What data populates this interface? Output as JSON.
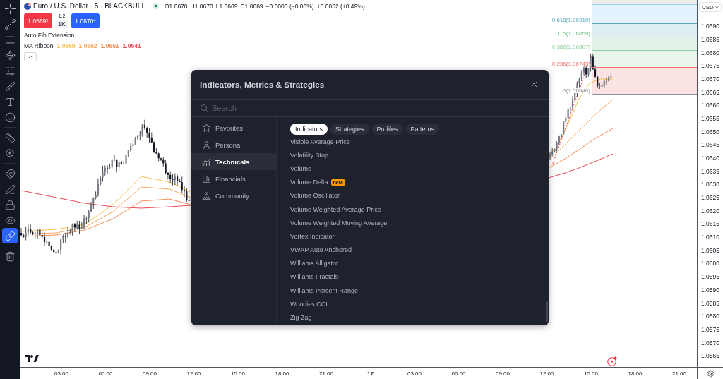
{
  "toolbar": {
    "groups": [
      {
        "tools": [
          {
            "selected": false
          },
          {
            "selected": false
          },
          {
            "selected": false
          },
          {
            "selected": false
          },
          {
            "selected": false
          },
          {
            "selected": false
          },
          {
            "selected": false
          },
          {
            "selected": false
          }
        ]
      },
      {
        "tools": [
          {
            "selected": false
          },
          {
            "selected": false
          }
        ]
      },
      {
        "tools": [
          {
            "selected": false
          },
          {
            "selected": false
          },
          {
            "selected": false
          },
          {
            "selected": false
          },
          {
            "selected": true
          }
        ]
      },
      {
        "tools": [
          {
            "selected": false
          }
        ]
      }
    ]
  },
  "legend": {
    "title": "Euro / U.S. Dollar · 5 · BLACKBULL",
    "quote": [
      "O1.0670",
      "H1.0670",
      "L1.0669",
      "C1.0669",
      "−0.0000 (−0.00%)",
      "+0.0052 (+0.49%)"
    ],
    "sell_price": "1.0669$^{2}$",
    "spread": "1.2",
    "quantity": "1K",
    "buy_price": "1.0670$^{4}$",
    "studies": [
      {
        "name": "Auto Fib Extension"
      },
      {
        "name": "MA Ribbon",
        "values": [
          {
            "text": "1.0669",
            "color": "#f5c14e"
          },
          {
            "text": "1.0662",
            "color": "#f9a85f"
          },
          {
            "text": "1.0651",
            "color": "#f28c55"
          },
          {
            "text": "1.0641",
            "color": "#e84c55"
          }
        ]
      }
    ]
  },
  "fib_levels": [
    {
      "label": "0.618(1.06910)",
      "color": "#5aa9bd"
    },
    {
      "label": "0.5(1.06859)",
      "color": "#72c08f"
    },
    {
      "label": "0.382(1.06807)",
      "color": "#8fcf9c"
    },
    {
      "label": "0.236(1.06743)",
      "color": "#f07373"
    },
    {
      "label": "0(1.06640)",
      "color": "#8e919a"
    }
  ],
  "price_axis": {
    "currency": "USD",
    "labels": [
      "1.0690",
      "1.0685",
      "1.0680",
      "1.0675",
      "1.0670",
      "1.0665",
      "1.0660",
      "1.0655",
      "1.0650",
      "1.0645",
      "1.0640",
      "1.0635",
      "1.0630",
      "1.0625",
      "1.0620",
      "1.0615",
      "1.0610",
      "1.0605",
      "1.0600",
      "1.0595",
      "1.0590",
      "1.0585",
      "1.0580",
      "1.0575",
      "1.0570",
      "1.0565"
    ]
  },
  "time_axis": {
    "labels": [
      {
        "text": "03:00",
        "kind": "time"
      },
      {
        "text": "06:00",
        "kind": "time"
      },
      {
        "text": "09:00",
        "kind": "time"
      },
      {
        "text": "12:00",
        "kind": "time"
      },
      {
        "text": "15:00",
        "kind": "time"
      },
      {
        "text": "18:00",
        "kind": "time"
      },
      {
        "text": "21:00",
        "kind": "time"
      },
      {
        "text": "17",
        "kind": "day"
      },
      {
        "text": "03:00",
        "kind": "time"
      },
      {
        "text": "06:00",
        "kind": "time"
      },
      {
        "text": "09:00",
        "kind": "time"
      },
      {
        "text": "12:00",
        "kind": "time"
      },
      {
        "text": "15:00",
        "kind": "time"
      },
      {
        "text": "18:00",
        "kind": "time"
      },
      {
        "text": "21:00",
        "kind": "time"
      }
    ]
  },
  "dialog": {
    "title": "Indicators, Metrics & Strategies",
    "search": {
      "placeholder": "Search"
    },
    "categories": [
      {
        "label": "Favorites",
        "selected": false
      },
      {
        "label": "Personal",
        "selected": false
      },
      {
        "label": "Technicals",
        "selected": true
      },
      {
        "label": "Financials",
        "selected": false
      },
      {
        "label": "Community",
        "selected": false
      }
    ],
    "tabs": [
      {
        "label": "Indicators",
        "selected": true
      },
      {
        "label": "Strategies",
        "selected": false
      },
      {
        "label": "Profiles",
        "selected": false
      },
      {
        "label": "Patterns",
        "selected": false
      }
    ],
    "items": [
      {
        "name": "Visible Average Price"
      },
      {
        "name": "Volatility Stop"
      },
      {
        "name": "Volume"
      },
      {
        "name": "Volume Delta",
        "badge": "beta"
      },
      {
        "name": "Volume Oscillator"
      },
      {
        "name": "Volume Weighted Average Price"
      },
      {
        "name": "Volume Weighted Moving Average"
      },
      {
        "name": "Vortex Indicator"
      },
      {
        "name": "VWAP Auto Anchored"
      },
      {
        "name": "Williams Alligator"
      },
      {
        "name": "Williams Fractals"
      },
      {
        "name": "Williams Percent Range"
      },
      {
        "name": "Woodies CCI"
      },
      {
        "name": "Zig Zag"
      }
    ]
  }
}
